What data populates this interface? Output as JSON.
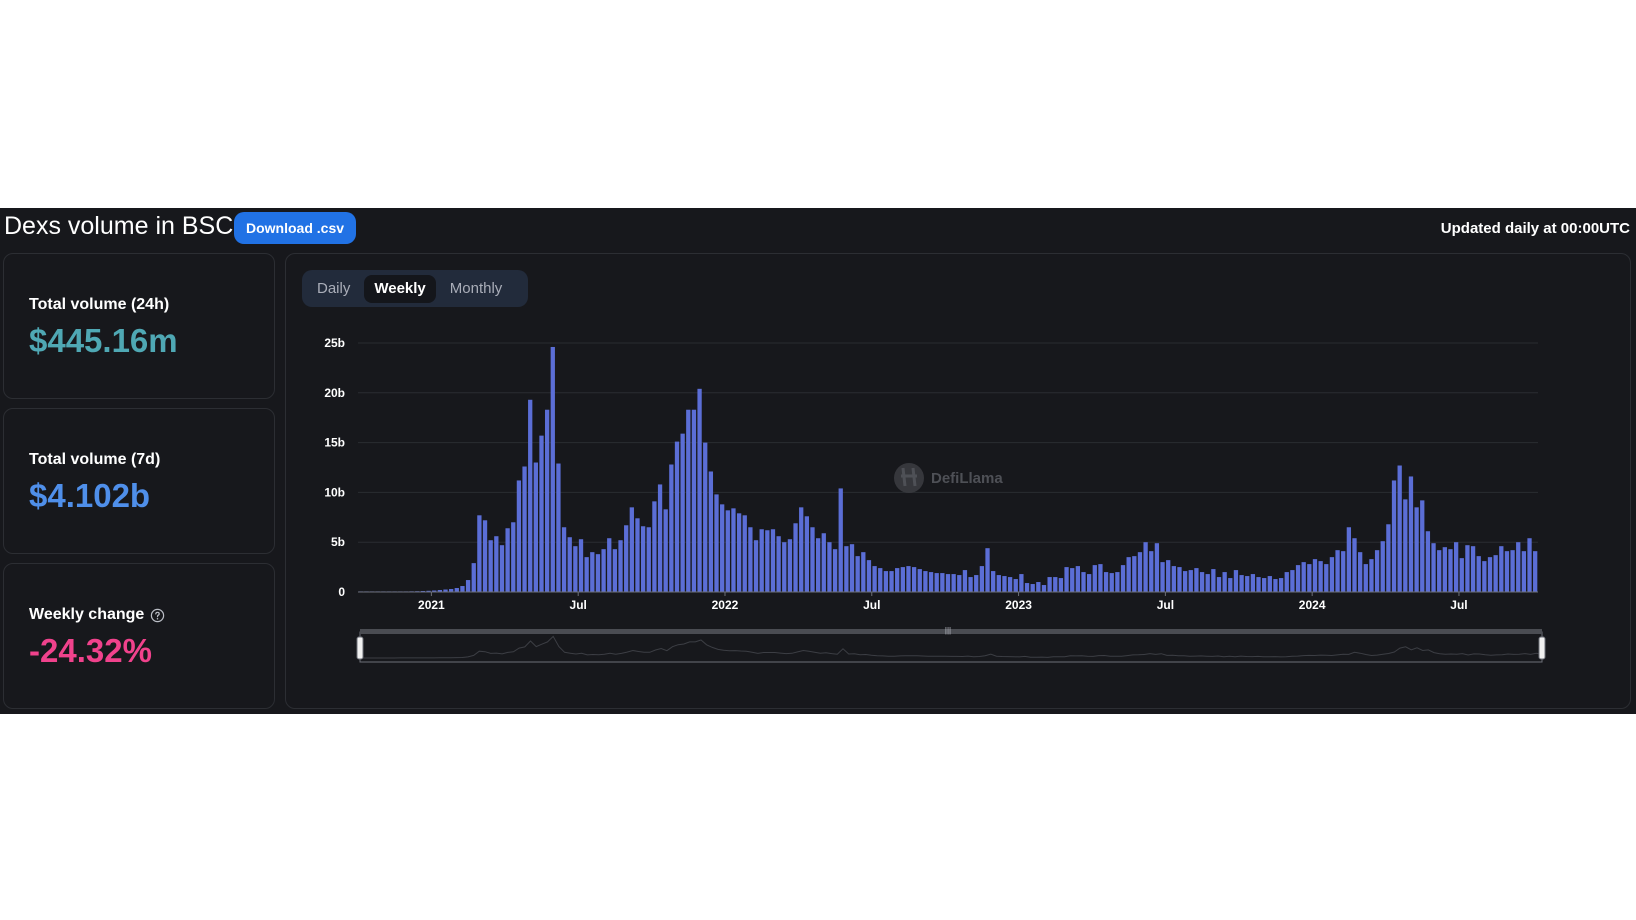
{
  "header": {
    "title": "Dexs volume in BSC",
    "download_label": "Download .csv",
    "updated": "Updated daily at 00:00UTC"
  },
  "stats": [
    {
      "label": "Total volume (24h)",
      "value": "$445.16m",
      "color": "#4fa8b4"
    },
    {
      "label": "Total volume (7d)",
      "value": "$4.102b",
      "color": "#4f8fea"
    },
    {
      "label": "Weekly change",
      "value": "-24.32%",
      "color": "#f0428c",
      "icon": "help-circle-icon"
    }
  ],
  "tabs": [
    {
      "label": "Daily",
      "active": false
    },
    {
      "label": "Weekly",
      "active": true
    },
    {
      "label": "Monthly",
      "active": false
    }
  ],
  "watermark": "DefiLlama",
  "colors": {
    "bar": "#5b6ed6",
    "background": "#17181c",
    "accent": "#2172e5"
  },
  "chart_data": {
    "type": "bar",
    "y_unit": "b",
    "ylim": [
      0,
      25
    ],
    "y_ticks": [
      {
        "value": 0,
        "label": "0"
      },
      {
        "value": 5,
        "label": "5b"
      },
      {
        "value": 10,
        "label": "10b"
      },
      {
        "value": 15,
        "label": "15b"
      },
      {
        "value": 20,
        "label": "20b"
      },
      {
        "value": 25,
        "label": "25b"
      }
    ],
    "x_ticks": [
      {
        "week": 13,
        "label": "2021",
        "bold": true
      },
      {
        "week": 39,
        "label": "Jul",
        "bold": false
      },
      {
        "week": 65,
        "label": "2022",
        "bold": true
      },
      {
        "week": 91,
        "label": "Jul",
        "bold": false
      },
      {
        "week": 117,
        "label": "2023",
        "bold": true
      },
      {
        "week": 143,
        "label": "Jul",
        "bold": false
      },
      {
        "week": 169,
        "label": "2024",
        "bold": true
      },
      {
        "week": 195,
        "label": "Jul",
        "bold": false
      }
    ],
    "grid": true,
    "values": [
      0.02,
      0.03,
      0.04,
      0.05,
      0.05,
      0.05,
      0.05,
      0.06,
      0.06,
      0.07,
      0.08,
      0.1,
      0.12,
      0.15,
      0.2,
      0.25,
      0.3,
      0.4,
      0.6,
      1.2,
      2.9,
      7.7,
      7.2,
      5.2,
      5.6,
      4.7,
      6.4,
      7.0,
      11.2,
      12.6,
      19.3,
      13.0,
      15.7,
      18.3,
      24.6,
      12.9,
      6.5,
      5.5,
      4.6,
      5.3,
      3.5,
      4.0,
      3.8,
      4.3,
      5.4,
      4.3,
      5.2,
      6.7,
      8.5,
      7.4,
      6.6,
      6.5,
      9.1,
      10.8,
      8.3,
      12.8,
      15.1,
      15.9,
      18.3,
      18.3,
      20.4,
      15.0,
      12.1,
      9.8,
      8.8,
      8.2,
      8.4,
      7.9,
      7.7,
      6.5,
      5.2,
      6.3,
      6.2,
      6.3,
      5.6,
      5.0,
      5.3,
      6.9,
      8.5,
      7.6,
      6.5,
      5.4,
      5.9,
      5.0,
      4.3,
      10.4,
      4.6,
      4.8,
      3.6,
      4.0,
      3.2,
      2.6,
      2.4,
      2.1,
      2.1,
      2.4,
      2.5,
      2.6,
      2.5,
      2.3,
      2.1,
      2.0,
      1.9,
      1.9,
      1.8,
      1.8,
      1.7,
      2.2,
      1.5,
      1.7,
      2.6,
      4.4,
      2.1,
      1.7,
      1.6,
      1.5,
      1.3,
      1.8,
      0.9,
      0.8,
      1.0,
      0.7,
      1.5,
      1.5,
      1.4,
      2.5,
      2.4,
      2.6,
      2.0,
      1.8,
      2.7,
      2.8,
      2.0,
      1.9,
      2.0,
      2.7,
      3.5,
      3.6,
      4.0,
      5.0,
      4.1,
      4.9,
      3.0,
      3.2,
      2.6,
      2.5,
      2.1,
      2.2,
      2.4,
      2.0,
      1.8,
      2.3,
      1.5,
      2.0,
      1.4,
      2.2,
      1.7,
      1.6,
      1.8,
      1.5,
      1.4,
      1.6,
      1.3,
      1.4,
      2.0,
      2.2,
      2.7,
      3.0,
      2.8,
      3.3,
      3.1,
      2.8,
      3.5,
      4.2,
      4.1,
      6.5,
      5.4,
      4.0,
      2.8,
      3.3,
      4.2,
      5.1,
      6.8,
      11.2,
      12.7,
      9.3,
      11.6,
      8.5,
      9.2,
      6.1,
      4.9,
      4.2,
      4.5,
      4.3,
      5.0,
      3.4,
      4.7,
      4.6,
      3.6,
      3.1,
      3.5,
      3.7,
      4.6,
      4.1,
      4.2,
      5.0,
      4.1,
      5.4,
      4.1
    ]
  }
}
